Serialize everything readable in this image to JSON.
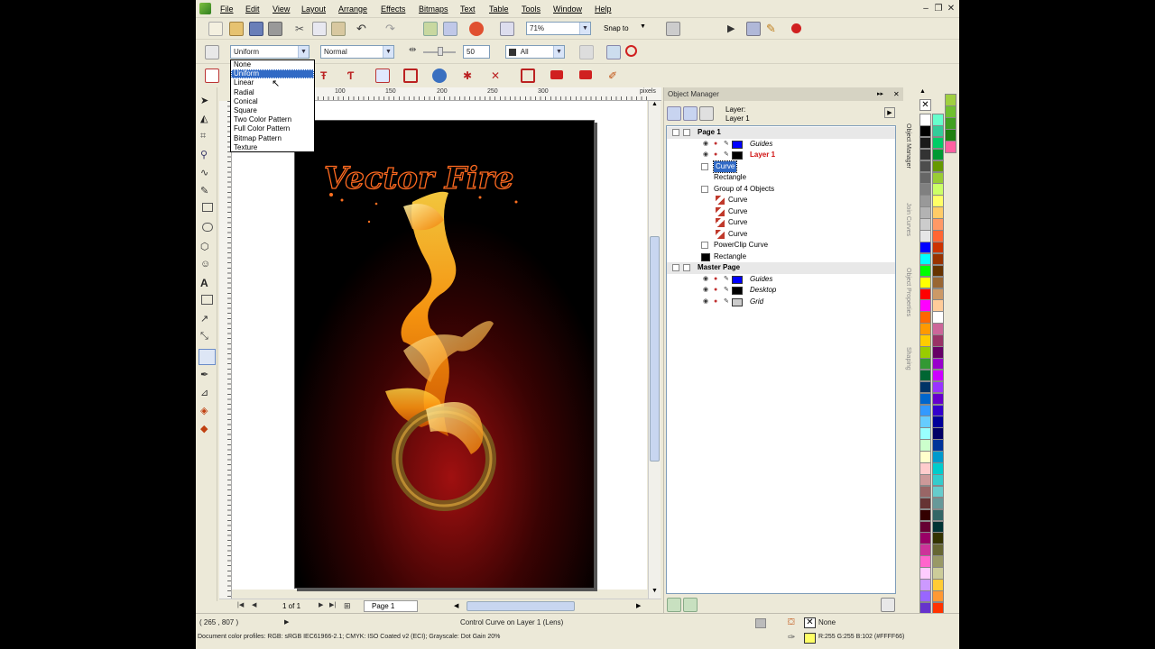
{
  "menu": [
    "File",
    "Edit",
    "View",
    "Layout",
    "Arrange",
    "Effects",
    "Bitmaps",
    "Text",
    "Table",
    "Tools",
    "Window",
    "Help"
  ],
  "toolbar": {
    "zoom": "71%",
    "snap_to": "Snap to"
  },
  "property_bar": {
    "fill_type": "Uniform",
    "merge_mode": "Normal",
    "transparency_value": "50",
    "apply_to": "All"
  },
  "fill_type_dropdown": {
    "options": [
      "None",
      "Uniform",
      "Linear",
      "Radial",
      "Conical",
      "Square",
      "Two Color Pattern",
      "Full Color Pattern",
      "Bitmap Pattern",
      "Texture"
    ],
    "selected_index": 1
  },
  "ruler": {
    "top_ticks": [
      "100",
      "150",
      "200",
      "250",
      "300"
    ],
    "unit": "pixels"
  },
  "artwork": {
    "title_text": "Vector Fire"
  },
  "page_nav": {
    "position": "1 of 1",
    "tab": "Page 1"
  },
  "object_manager": {
    "title": "Object Manager",
    "header_layer_label": "Layer:",
    "header_layer_name": "Layer 1",
    "tree": [
      {
        "label": "Page 1",
        "indent": 0,
        "bold": true,
        "exp": true
      },
      {
        "label": "Guides",
        "indent": 1,
        "italic": true,
        "swatch": "#0000ff",
        "eye": true
      },
      {
        "label": "Layer 1",
        "indent": 1,
        "bold": true,
        "red": true,
        "swatch": "#000000",
        "eye": true
      },
      {
        "label": "Curve",
        "indent": 2,
        "selected": true,
        "exp": true
      },
      {
        "label": "Rectangle",
        "indent": 2
      },
      {
        "label": "Group of 4 Objects",
        "indent": 2,
        "exp": true
      },
      {
        "label": "Curve",
        "indent": 3,
        "curve": true
      },
      {
        "label": "Curve",
        "indent": 3,
        "curve": true
      },
      {
        "label": "Curve",
        "indent": 3,
        "curve": true
      },
      {
        "label": "Curve",
        "indent": 3,
        "curve": true
      },
      {
        "label": "PowerClip Curve",
        "indent": 2,
        "exp": true
      },
      {
        "label": "Rectangle",
        "indent": 2,
        "blackicon": true
      },
      {
        "label": "Master Page",
        "indent": 0,
        "bold": true,
        "exp": true
      },
      {
        "label": "Guides",
        "indent": 1,
        "italic": true,
        "swatch": "#0000ff",
        "eye": true
      },
      {
        "label": "Desktop",
        "indent": 1,
        "italic": true,
        "swatch": "#000000",
        "eye": true
      },
      {
        "label": "Grid",
        "indent": 1,
        "italic": true,
        "swatch": "#cccccc",
        "eye": true
      }
    ]
  },
  "side_tabs": [
    "Object Manager",
    "Join Curves",
    "Object Properties",
    "Shaping"
  ],
  "palette_colors": [
    "#ffffff",
    "#000000",
    "#1a1a1a",
    "#333333",
    "#4d4d4d",
    "#666666",
    "#808080",
    "#999999",
    "#b3b3b3",
    "#cccccc",
    "#e6e6e6",
    "#0000ff",
    "#00ffff",
    "#00ff00",
    "#ffff00",
    "#ff0000",
    "#ff00ff",
    "#ff6600",
    "#ff9900",
    "#ffcc00",
    "#99cc00",
    "#339933",
    "#006633",
    "#003366",
    "#0066cc",
    "#3399ff",
    "#66ccff",
    "#99ffff",
    "#ccffcc",
    "#ffffcc",
    "#ffcccc",
    "#cc9999",
    "#996666",
    "#663333",
    "#330000",
    "#660033",
    "#990066",
    "#cc3399",
    "#ff66cc",
    "#ffccff",
    "#cc99ff",
    "#9966ff",
    "#6633cc",
    "#330099"
  ],
  "palette_colors_2": [
    "#66ffcc",
    "#33cc99",
    "#00cc66",
    "#009933",
    "#669900",
    "#99cc33",
    "#ccff66",
    "#ffff66",
    "#ffcc66",
    "#ff9966",
    "#ff6633",
    "#cc3300",
    "#993300",
    "#663300",
    "#996633",
    "#cc9966",
    "#ffcc99",
    "#ffffff",
    "#cc6699",
    "#993366",
    "#660066",
    "#9900cc",
    "#cc00ff",
    "#9933ff",
    "#6600cc",
    "#3300cc",
    "#000099",
    "#000066",
    "#003399",
    "#0099cc",
    "#00cccc",
    "#33cccc",
    "#66cccc",
    "#669999",
    "#336666",
    "#003333",
    "#333300",
    "#666633",
    "#999966",
    "#cccc99",
    "#ffcc33",
    "#ff9933",
    "#ff3300",
    "#cc0033"
  ],
  "status": {
    "coords": "( 265 , 807 )",
    "message": "Control Curve on Layer 1 (Lens)",
    "profiles": "Document color profiles: RGB: sRGB IEC61966-2.1; CMYK: ISO Coated v2 (ECI); Grayscale: Dot Gain 20%",
    "fill_label": "None",
    "color_values": "R:255 G:255 B:102 (#FFFF66)"
  }
}
